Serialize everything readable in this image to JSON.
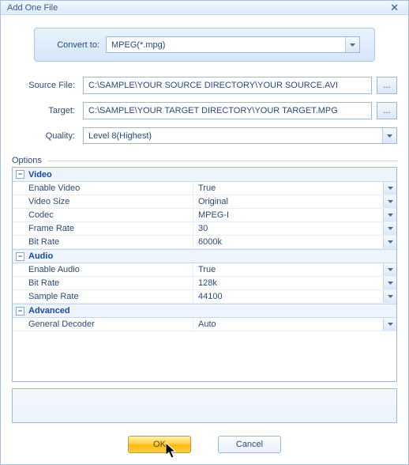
{
  "window": {
    "title": "Add One File"
  },
  "convert": {
    "label": "Convert to:",
    "value": "MPEG(*.mpg)"
  },
  "fields": {
    "source_label": "Source File:",
    "source_value": "C:\\SAMPLE\\YOUR SOURCE DIRECTORY\\YOUR SOURCE.AVI",
    "target_label": "Target:",
    "target_value": "C:\\SAMPLE\\YOUR TARGET DIRECTORY\\YOUR TARGET.MPG",
    "quality_label": "Quality:",
    "quality_value": "Level 8(Highest)",
    "browse": "..."
  },
  "options_label": "Options",
  "categories": [
    {
      "name": "Video",
      "props": [
        {
          "name": "Enable Video",
          "value": "True"
        },
        {
          "name": "Video Size",
          "value": "Original"
        },
        {
          "name": "Codec",
          "value": "MPEG-I"
        },
        {
          "name": "Frame Rate",
          "value": "30"
        },
        {
          "name": "Bit Rate",
          "value": "6000k"
        }
      ]
    },
    {
      "name": "Audio",
      "props": [
        {
          "name": "Enable Audio",
          "value": "True"
        },
        {
          "name": "Bit Rate",
          "value": "128k"
        },
        {
          "name": "Sample Rate",
          "value": "44100"
        }
      ]
    },
    {
      "name": "Advanced",
      "props": [
        {
          "name": "General Decoder",
          "value": "Auto"
        }
      ]
    }
  ],
  "buttons": {
    "ok": "OK",
    "cancel": "Cancel"
  },
  "collapse_glyph": "−"
}
